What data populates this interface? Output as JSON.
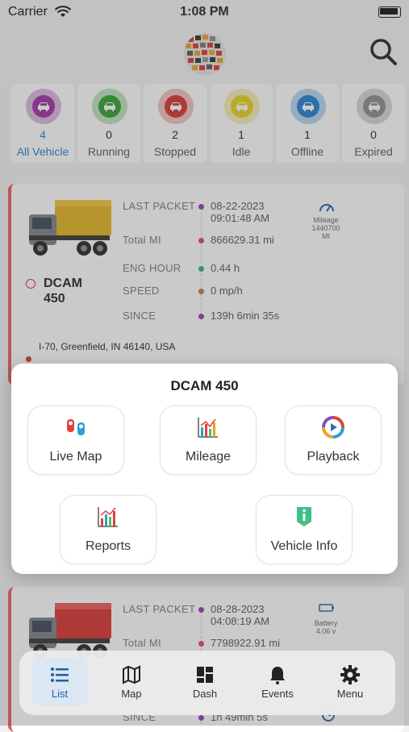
{
  "status_bar": {
    "carrier": "Carrier",
    "time": "1:08 PM"
  },
  "filters": [
    {
      "count": "4",
      "label": "All Vehicle",
      "color": "#9b2fa5",
      "ring": "#d9b8dd",
      "active": true
    },
    {
      "count": "0",
      "label": "Running",
      "color": "#2f9e2f",
      "ring": "#bfe0bf",
      "active": false
    },
    {
      "count": "2",
      "label": "Stopped",
      "color": "#d9302c",
      "ring": "#f0c0bd",
      "active": false
    },
    {
      "count": "1",
      "label": "Idle",
      "color": "#e8d21b",
      "ring": "#f5eeb0",
      "active": false
    },
    {
      "count": "1",
      "label": "Offline",
      "color": "#1f7fd0",
      "ring": "#b7d5ee",
      "active": false
    },
    {
      "count": "0",
      "label": "Expired",
      "color": "#8c8c8c",
      "ring": "#d5d5d5",
      "active": false
    }
  ],
  "vehicle_card_1": {
    "name": "DCAM\n450",
    "rows": [
      {
        "label": "LAST PACKET",
        "value": "08-22-2023\n09:01:48 AM",
        "dot": "#8e3fa8"
      },
      {
        "label": "Total MI",
        "value": "866629.31 mi",
        "dot": "#e23d73"
      },
      {
        "label": "ENG HOUR",
        "value": "0.44 h",
        "dot": "#2fae8f"
      },
      {
        "label": "SPEED",
        "value": "0 mp/h",
        "dot": "#c27a2b"
      },
      {
        "label": "SINCE",
        "value": "139h 6min 35s",
        "dot": "#8a3fc2"
      }
    ],
    "badge": "Mileage\n1440700\nMI",
    "address": "I-70, Greenfield, IN 46140, USA"
  },
  "vehicle_card_2": {
    "rows": [
      {
        "label": "LAST PACKET",
        "value": "08-28-2023\n04:08:19 AM",
        "dot": "#8e3fa8"
      },
      {
        "label": "Total MI",
        "value": "7798922.91 mi",
        "dot": "#e23d73"
      },
      {
        "label": "SINCE",
        "value": "1h 49min 5s",
        "dot": "#8a3fc2"
      }
    ],
    "badge": "Battery\n4.06 v"
  },
  "sheet": {
    "title": "DCAM 450",
    "actions": [
      {
        "label": "Live Map",
        "icon": "live-map-icon"
      },
      {
        "label": "Mileage",
        "icon": "mileage-chart-icon"
      },
      {
        "label": "Playback",
        "icon": "playback-icon"
      },
      {
        "label": "Reports",
        "icon": "reports-chart-icon"
      },
      {
        "label": "Vehicle Info",
        "icon": "vehicle-info-icon"
      }
    ]
  },
  "tabbar": {
    "tabs": [
      {
        "label": "List",
        "icon": "list-icon",
        "active": true
      },
      {
        "label": "Map",
        "icon": "map-icon",
        "active": false
      },
      {
        "label": "Dash",
        "icon": "dashboard-icon",
        "active": false
      },
      {
        "label": "Events",
        "icon": "bell-icon",
        "active": false
      },
      {
        "label": "Menu",
        "icon": "gear-icon",
        "active": false
      }
    ]
  },
  "colors": {
    "accent": "#1f5fa8",
    "card_border": "#e55b5b"
  }
}
